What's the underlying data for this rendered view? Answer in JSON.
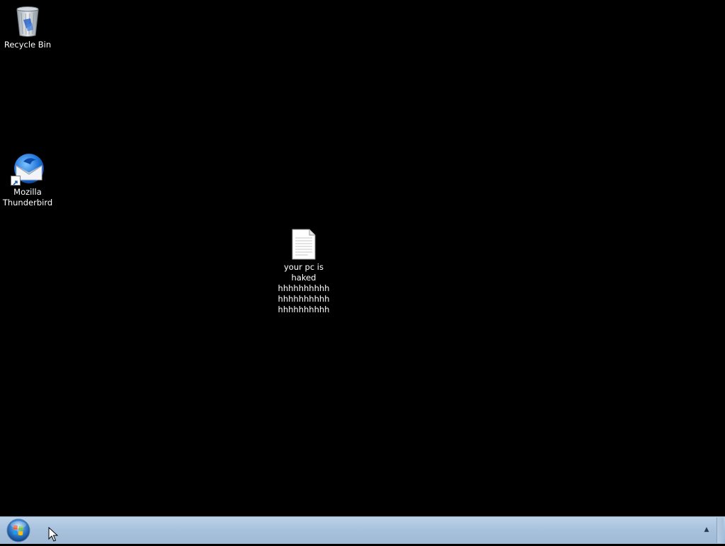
{
  "desktop": {
    "background_color": "#000000",
    "icons": [
      {
        "id": "recycle-bin",
        "label": "Recycle Bin",
        "icon": "recycle-bin-icon"
      },
      {
        "id": "thunderbird",
        "label": "Mozilla Thunderbird",
        "icon": "thunderbird-icon"
      },
      {
        "id": "text-file",
        "label": "your pc is haked hhhhhhhhhh hhhhhhhhhh hhhhhhhhhh",
        "icon": "text-document-icon"
      }
    ]
  },
  "taskbar": {
    "color": "#a9c3de",
    "start_button": {
      "icon": "windows-start-orb-icon"
    },
    "tray": {
      "chevron_icon": "chevron-up-icon",
      "chevron_glyph": "▲",
      "show_desktop": "show-desktop-button"
    }
  },
  "cursor": {
    "icon": "arrow-pointer-icon"
  }
}
